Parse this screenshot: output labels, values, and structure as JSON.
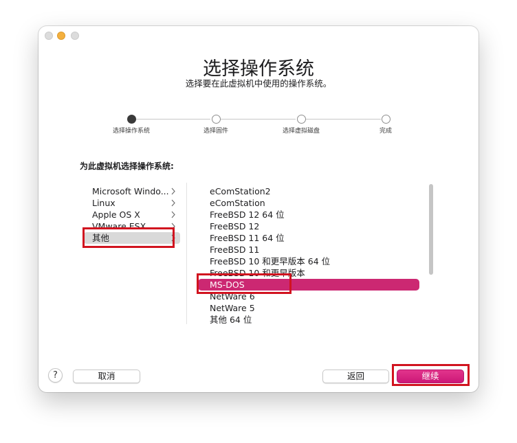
{
  "window": {
    "title": "选择操作系统",
    "subtitle": "选择要在此虚拟机中使用的操作系统。"
  },
  "steps": [
    {
      "label": "选择操作系统",
      "active": true
    },
    {
      "label": "选择固件",
      "active": false
    },
    {
      "label": "选择虚拟磁盘",
      "active": false
    },
    {
      "label": "完成",
      "active": false
    }
  ],
  "section_label": "为此虚拟机选择操作系统:",
  "os_families": [
    {
      "label": "Microsoft Windo...",
      "has_submenu": true
    },
    {
      "label": "Linux",
      "has_submenu": true
    },
    {
      "label": "Apple OS X",
      "has_submenu": true
    },
    {
      "label": "VMware ESX",
      "has_submenu": true
    },
    {
      "label": "其他",
      "has_submenu": true,
      "selected": true
    }
  ],
  "os_versions": [
    {
      "label": "eComStation2"
    },
    {
      "label": "eComStation"
    },
    {
      "label": "FreeBSD 12 64 位"
    },
    {
      "label": "FreeBSD 12"
    },
    {
      "label": "FreeBSD 11 64 位"
    },
    {
      "label": "FreeBSD 11"
    },
    {
      "label": "FreeBSD 10 和更早版本 64 位"
    },
    {
      "label": "FreeBSD 10 和更早版本"
    },
    {
      "label": "MS-DOS",
      "selected": true
    },
    {
      "label": "NetWare 6"
    },
    {
      "label": "NetWare 5"
    },
    {
      "label": "其他 64 位"
    }
  ],
  "buttons": {
    "help": "?",
    "cancel": "取消",
    "back": "返回",
    "continue": "继续"
  },
  "colors": {
    "accent": "#cc2872",
    "highlight_box": "#d1131f"
  }
}
